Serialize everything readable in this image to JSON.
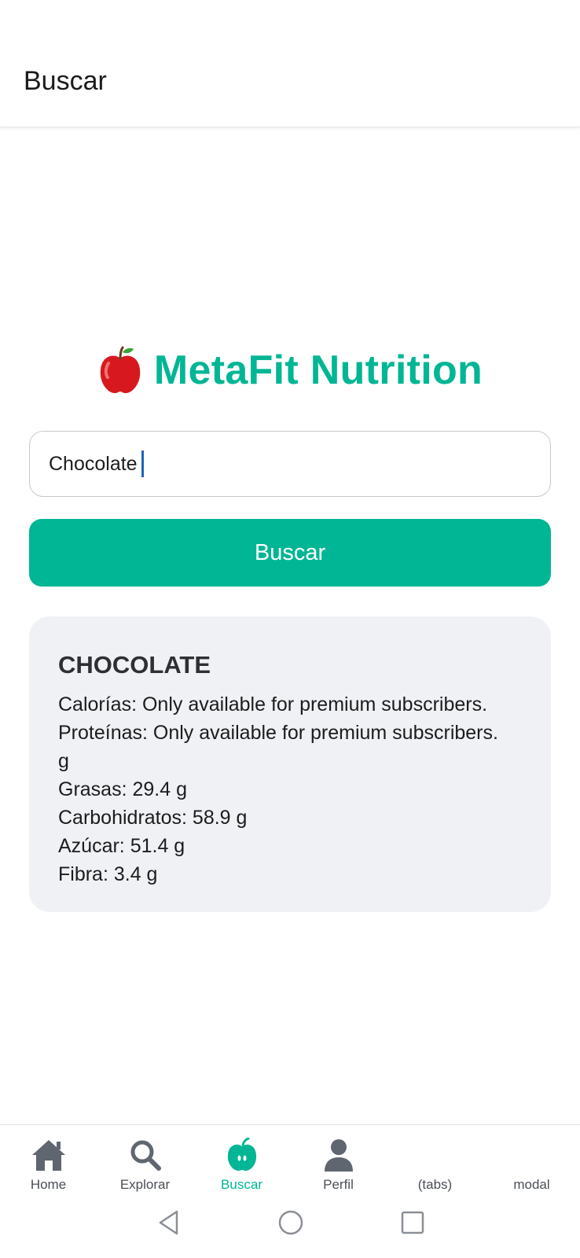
{
  "header": {
    "title": "Buscar"
  },
  "brand": {
    "emoji": "🍎",
    "title": "MetaFit Nutrition"
  },
  "search": {
    "value": "Chocolate",
    "button_label": "Buscar"
  },
  "result": {
    "name": "CHOCOLATE",
    "lines": [
      "Calorías: Only available for premium subscribers.",
      "Proteínas: Only available for premium subscribers.",
      "g",
      "Grasas: 29.4 g",
      "Carbohidratos: 58.9 g",
      "Azúcar: 51.4 g",
      "Fibra: 3.4 g"
    ]
  },
  "tabs": [
    {
      "label": "Home",
      "icon": "home-icon",
      "active": false
    },
    {
      "label": "Explorar",
      "icon": "search-icon",
      "active": false
    },
    {
      "label": "Buscar",
      "icon": "apple-icon",
      "active": true
    },
    {
      "label": "Perfil",
      "icon": "person-icon",
      "active": false
    },
    {
      "label": "(tabs)",
      "icon": "",
      "active": false
    },
    {
      "label": "modal",
      "icon": "",
      "active": false
    }
  ],
  "system_nav": {
    "icons": [
      "back-icon",
      "home-circle-icon",
      "recents-icon"
    ]
  },
  "colors": {
    "accent": "#00b694",
    "card_bg": "#eff1f5",
    "inactive_icon": "#5f6670"
  }
}
